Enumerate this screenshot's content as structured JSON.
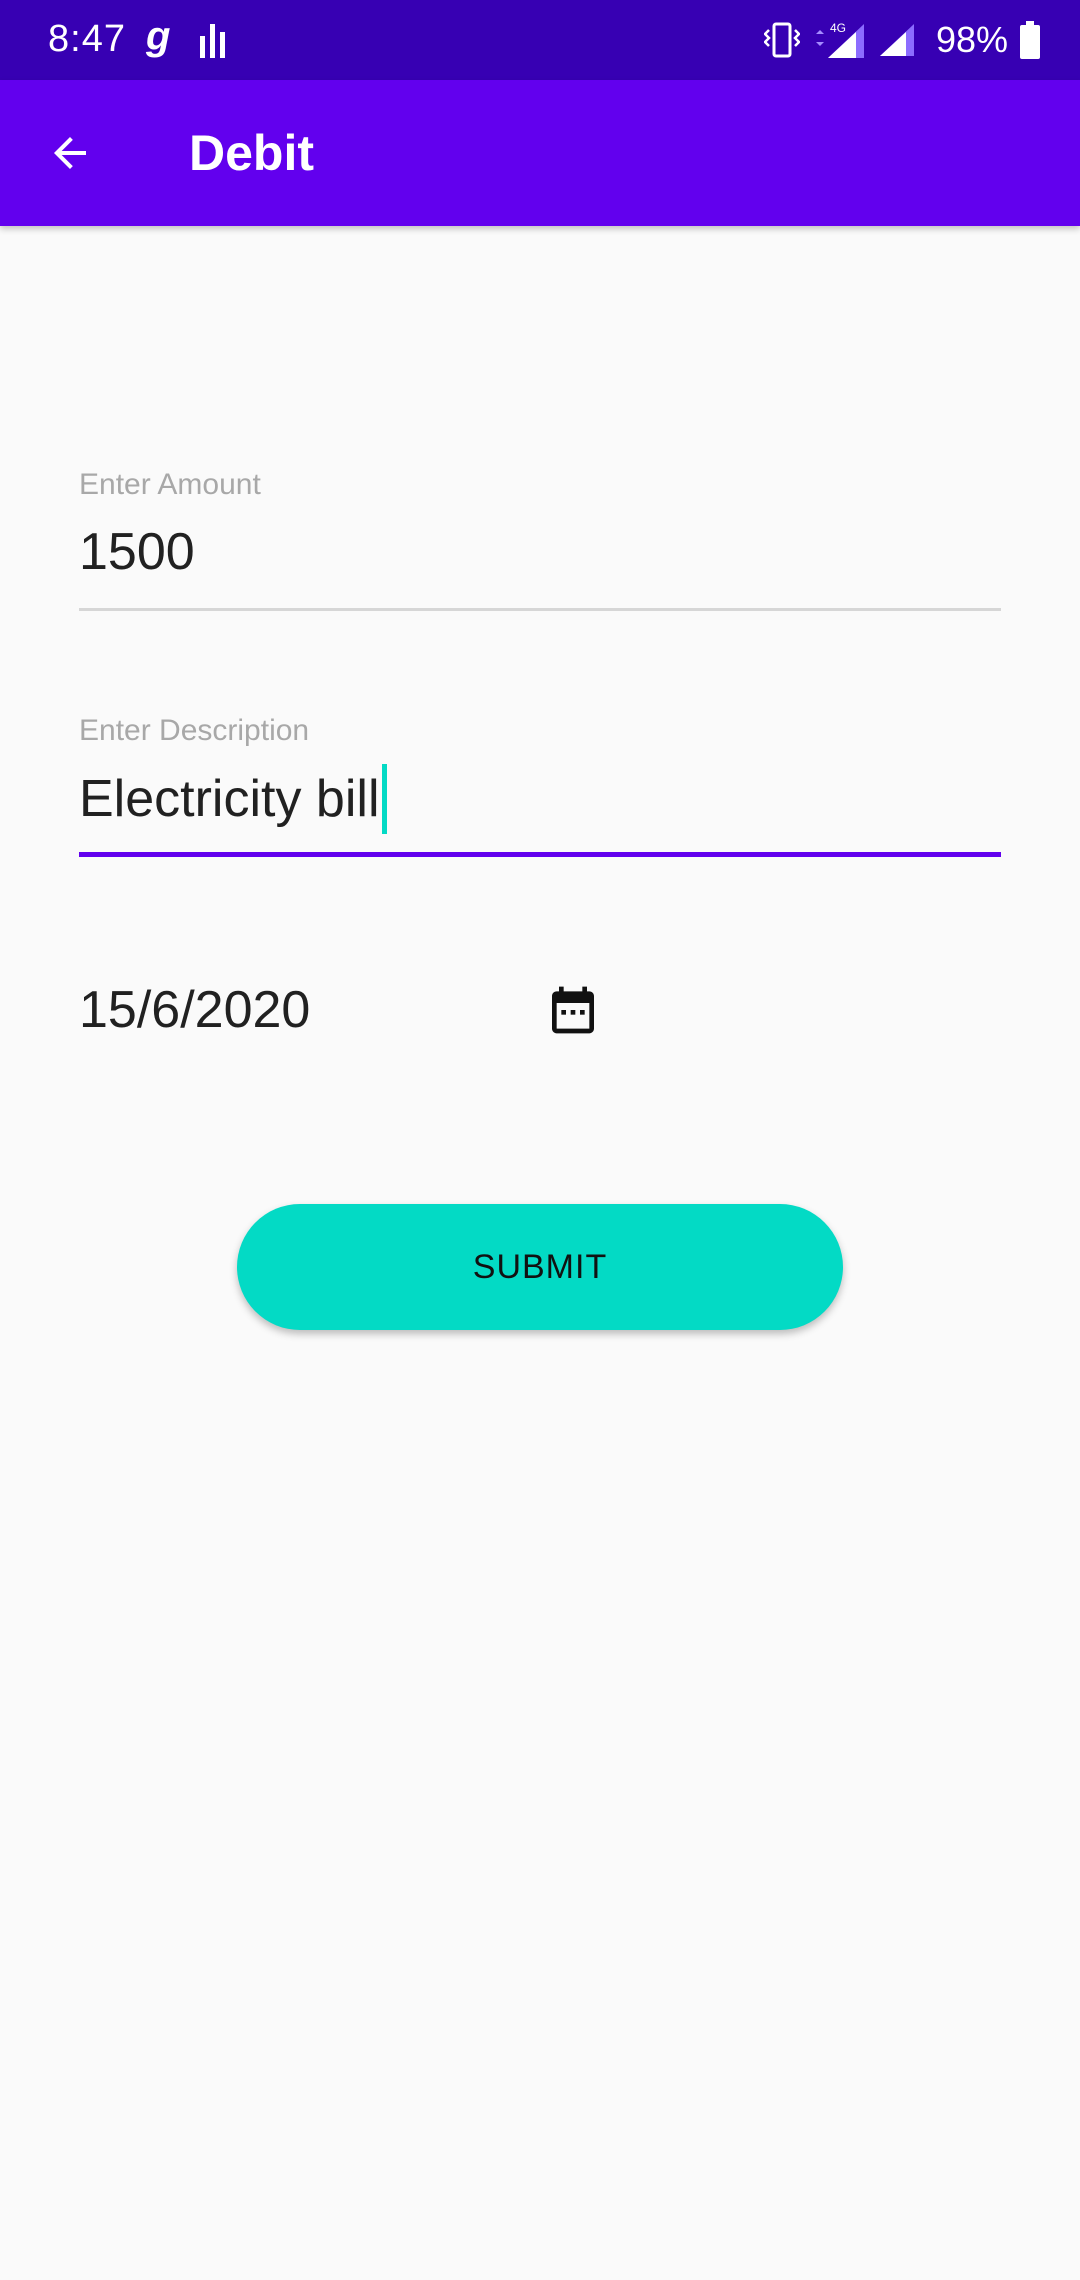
{
  "status_bar": {
    "time": "8:47",
    "carrier_glyph": "g",
    "network_label": "4G",
    "battery": "98%",
    "icons": [
      "vibrate-icon",
      "signal-4g-icon",
      "signal-icon",
      "battery-icon"
    ]
  },
  "app_bar": {
    "title": "Debit",
    "back_icon": "arrow-back-icon",
    "color": "#6200ee"
  },
  "form": {
    "amount": {
      "label": "Enter Amount",
      "value": "1500"
    },
    "description": {
      "label": "Enter Description",
      "value": "Electricity bill"
    },
    "date": {
      "value": "15/6/2020",
      "icon": "calendar-icon"
    },
    "submit_label": "SUBMIT"
  },
  "colors": {
    "primary": "#6200ee",
    "primary_dark": "#3700b3",
    "accent": "#03dac5"
  }
}
